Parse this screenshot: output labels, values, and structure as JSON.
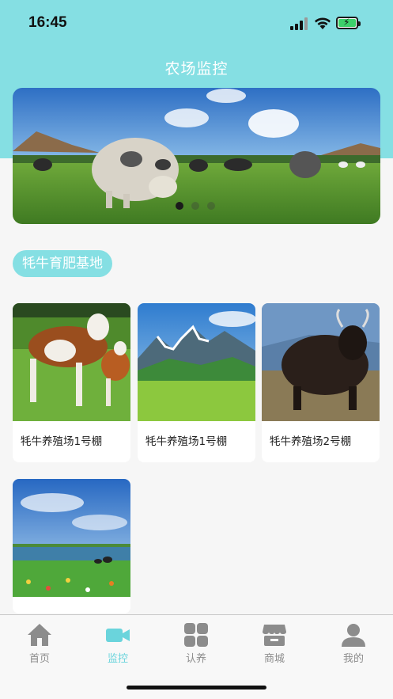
{
  "status_bar": {
    "time": "16:45"
  },
  "header": {
    "title": "农场监控"
  },
  "banner": {
    "slides": 3,
    "active_slide": 1
  },
  "section": {
    "tag": "牦牛育肥基地"
  },
  "cards": [
    {
      "label": "牦牛养殖场1号棚"
    },
    {
      "label": "牦牛养殖场1号棚"
    },
    {
      "label": "牦牛养殖场2号棚"
    },
    {
      "label": ""
    }
  ],
  "tabbar": {
    "items": [
      {
        "label": "首页",
        "icon": "home-icon"
      },
      {
        "label": "监控",
        "icon": "camera-icon"
      },
      {
        "label": "认养",
        "icon": "grid-icon"
      },
      {
        "label": "商城",
        "icon": "store-icon"
      },
      {
        "label": "我的",
        "icon": "user-icon"
      }
    ],
    "active": "监控"
  },
  "colors": {
    "accent": "#85dfe3",
    "active_tab": "#6ad4dc",
    "inactive_tab": "#8c8c8c"
  }
}
